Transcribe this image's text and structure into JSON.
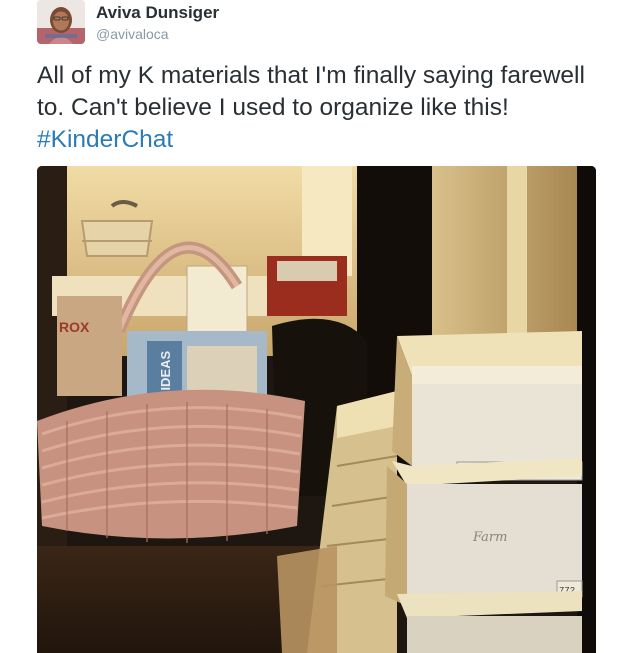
{
  "tweet": {
    "author_name": "Aviva Dunsiger",
    "author_handle": "@avivaloca",
    "text_before": "All of my K materials that I'm finally saying farewell to. Can't believe I used to organize like this! ",
    "hashtag": "#KinderChat"
  },
  "photo": {
    "box_labels": [
      "772",
      "Farm",
      "772"
    ],
    "binder_label": "VISTA IDEAS",
    "basket_label": "ROX"
  },
  "colors": {
    "text": "#292f33",
    "handle": "#8899a6",
    "hashtag": "#2b7bb9"
  }
}
